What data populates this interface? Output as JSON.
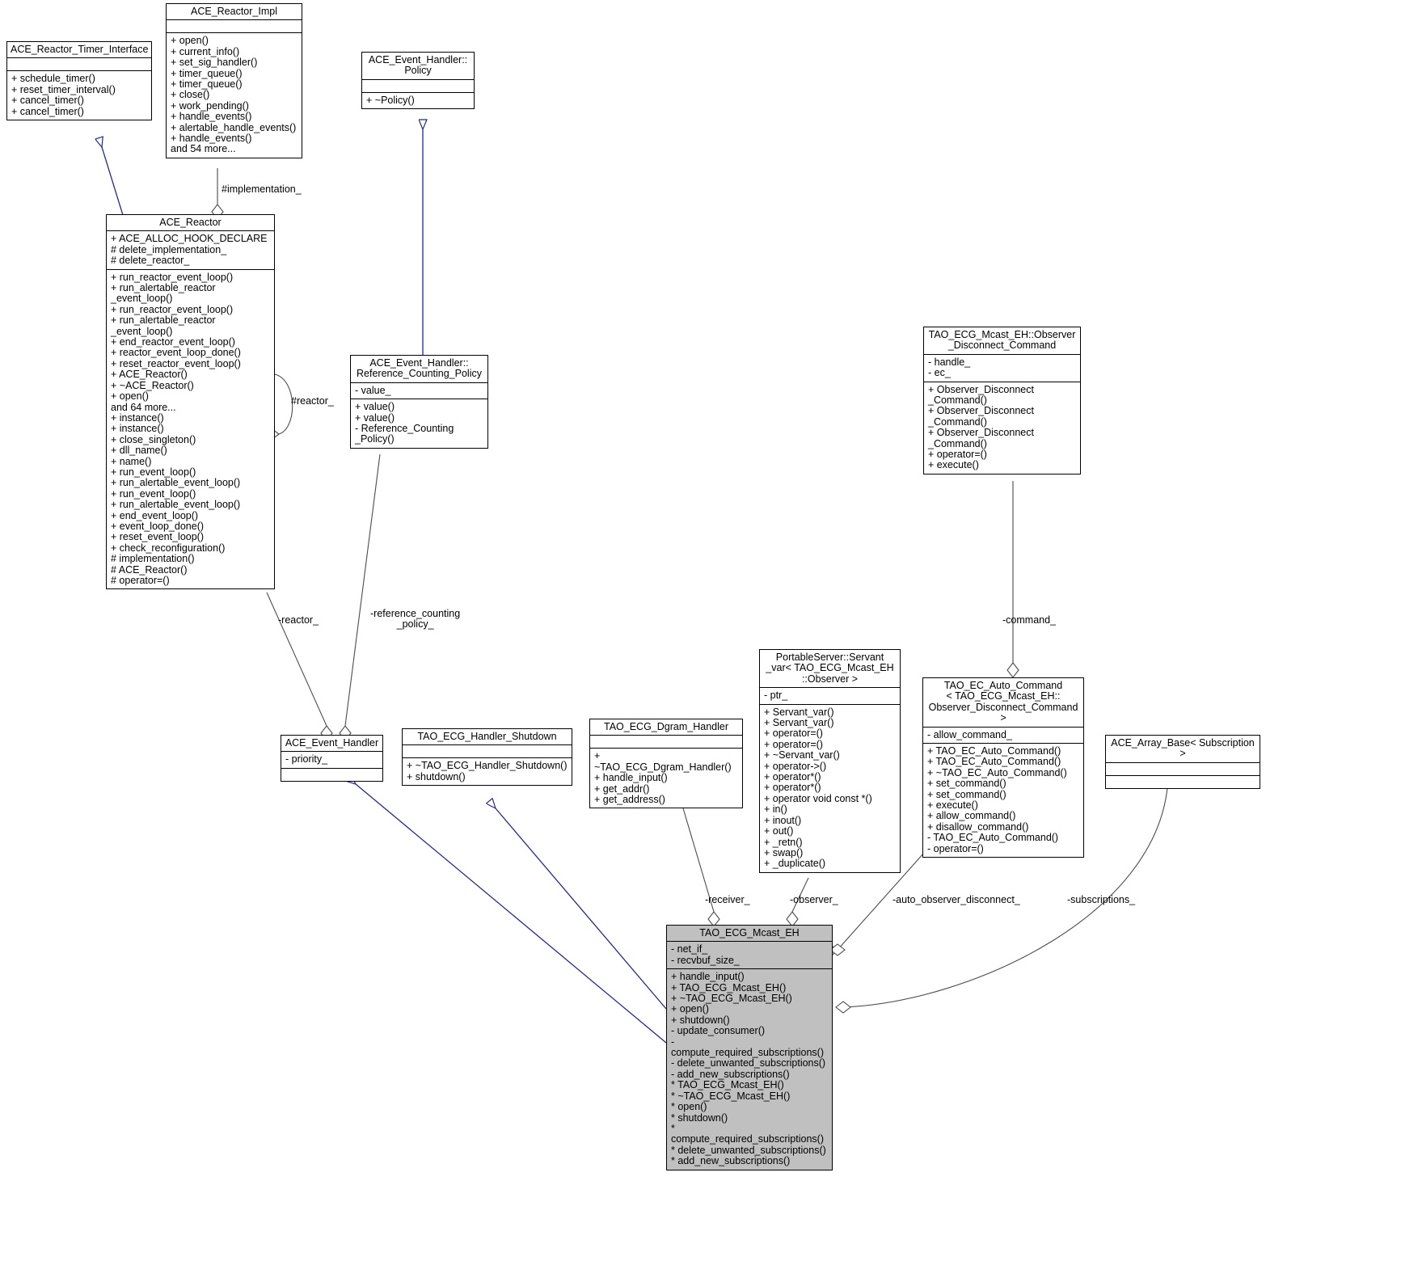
{
  "diagram": {
    "kind": "uml-class-diagram",
    "colors": {
      "inheritance_edge": "#26268c",
      "association_edge": "#4c4c4c",
      "node_border": "#000000",
      "node_fill": "#ffffff",
      "highlight_fill": "#c0c0c0"
    }
  },
  "classes": {
    "reactor_timer_interface": {
      "title": "ACE_Reactor_Timer_Interface",
      "attributes": "",
      "methods": "+ schedule_timer()\n+ reset_timer_interval()\n+ cancel_timer()\n+ cancel_timer()"
    },
    "reactor_impl": {
      "title": "ACE_Reactor_Impl",
      "attributes": "",
      "methods": "+ open()\n+ current_info()\n+ set_sig_handler()\n+ timer_queue()\n+ timer_queue()\n+ close()\n+ work_pending()\n+ handle_events()\n+ alertable_handle_events()\n+ handle_events()\nand 54 more..."
    },
    "eh_policy": {
      "title": "ACE_Event_Handler::\nPolicy",
      "attributes": "",
      "methods": "+ ~Policy()"
    },
    "ace_reactor": {
      "title": "ACE_Reactor",
      "attributes": "+ ACE_ALLOC_HOOK_DECLARE\n# delete_implementation_\n# delete_reactor_",
      "methods": "+ run_reactor_event_loop()\n+ run_alertable_reactor\n_event_loop()\n+ run_reactor_event_loop()\n+ run_alertable_reactor\n_event_loop()\n+ end_reactor_event_loop()\n+ reactor_event_loop_done()\n+ reset_reactor_event_loop()\n+ ACE_Reactor()\n+ ~ACE_Reactor()\n+ open()\nand 64 more...\n+ instance()\n+ instance()\n+ close_singleton()\n+ dll_name()\n+ name()\n+ run_event_loop()\n+ run_alertable_event_loop()\n+ run_event_loop()\n+ run_alertable_event_loop()\n+ end_event_loop()\n+ event_loop_done()\n+ reset_event_loop()\n+ check_reconfiguration()\n# implementation()\n# ACE_Reactor()\n# operator=()"
    },
    "ref_counting_policy": {
      "title": "ACE_Event_Handler::\nReference_Counting_Policy",
      "attributes": "- value_",
      "methods": "+ value()\n+ value()\n- Reference_Counting\n_Policy()"
    },
    "observer_disconnect_command": {
      "title": "TAO_ECG_Mcast_EH::Observer\n_Disconnect_Command",
      "attributes": "- handle_\n- ec_",
      "methods": "+ Observer_Disconnect\n_Command()\n+ Observer_Disconnect\n_Command()\n+ Observer_Disconnect\n_Command()\n+ operator=()\n+ execute()"
    },
    "ace_event_handler": {
      "title": "ACE_Event_Handler",
      "attributes": "- priority_",
      "methods": ""
    },
    "handler_shutdown": {
      "title": "TAO_ECG_Handler_Shutdown",
      "attributes": "",
      "methods": "+ ~TAO_ECG_Handler_Shutdown()\n+ shutdown()"
    },
    "dgram_handler": {
      "title": "TAO_ECG_Dgram_Handler",
      "attributes": "",
      "methods": "+ ~TAO_ECG_Dgram_Handler()\n+ handle_input()\n+ get_addr()\n+ get_address()"
    },
    "servant_var": {
      "title": "PortableServer::Servant\n_var< TAO_ECG_Mcast_EH\n::Observer >",
      "attributes": "- ptr_",
      "methods": "+ Servant_var()\n+ Servant_var()\n+ operator=()\n+ operator=()\n+ ~Servant_var()\n+ operator->()\n+ operator*()\n+ operator*()\n+ operator void const *()\n+ in()\n+ inout()\n+ out()\n+ _retn()\n+ swap()\n+ _duplicate()"
    },
    "auto_command": {
      "title": "TAO_EC_Auto_Command\n< TAO_ECG_Mcast_EH::\nObserver_Disconnect_Command >",
      "attributes": "- allow_command_",
      "methods": "+ TAO_EC_Auto_Command()\n+ TAO_EC_Auto_Command()\n+ ~TAO_EC_Auto_Command()\n+ set_command()\n+ set_command()\n+ execute()\n+ allow_command()\n+ disallow_command()\n- TAO_EC_Auto_Command()\n- operator=()"
    },
    "array_base": {
      "title": "ACE_Array_Base< Subscription >",
      "attributes": "",
      "methods": ""
    },
    "mcast_eh": {
      "title": "TAO_ECG_Mcast_EH",
      "attributes": "- net_if_\n- recvbuf_size_",
      "methods": "+ handle_input()\n+ TAO_ECG_Mcast_EH()\n+ ~TAO_ECG_Mcast_EH()\n+ open()\n+ shutdown()\n- update_consumer()\n- compute_required_subscriptions()\n- delete_unwanted_subscriptions()\n- add_new_subscriptions()\n* TAO_ECG_Mcast_EH()\n* ~TAO_ECG_Mcast_EH()\n* open()\n* shutdown()\n* compute_required_subscriptions()\n* delete_unwanted_subscriptions()\n* add_new_subscriptions()"
    }
  },
  "edge_labels": {
    "implementation": "#implementation_",
    "reactor_field": "#reactor_",
    "reactor_assoc": "-reactor_",
    "reference_counting_policy": "-reference_counting\n_policy_",
    "command": "-command_",
    "receiver": "-receiver_",
    "observer": "-observer_",
    "auto_observer_disconnect": "-auto_observer_disconnect_",
    "subscriptions": "-subscriptions_"
  }
}
